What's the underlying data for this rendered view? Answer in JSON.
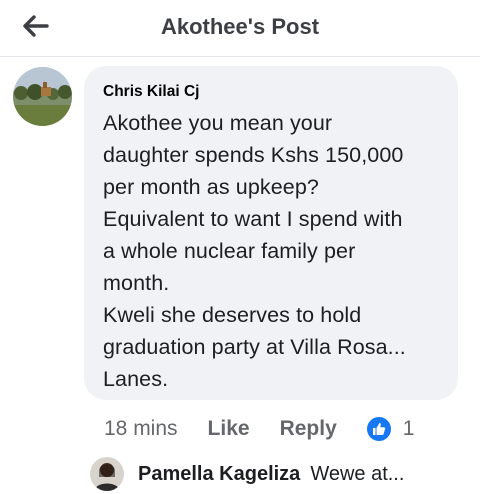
{
  "header": {
    "title": "Akothee's Post",
    "back_icon": "arrow-left-icon"
  },
  "comment": {
    "author": "Chris Kilai Cj",
    "text": "Akothee you mean your\ndaughter spends Kshs 150,000\nper month as upkeep?\nEquivalent to want I spend with\na whole nuclear family per\nmonth.\nKweli she deserves to hold\ngraduation party at Villa Rosa...\nLanes.",
    "time": "18 mins",
    "like_label": "Like",
    "reply_label": "Reply",
    "reaction_icon": "thumbs-up-icon",
    "reaction_count": "1"
  },
  "reply_preview": {
    "author": "Pamella Kageliza",
    "snippet": "Wewe at..."
  },
  "colors": {
    "accent": "#1877f2",
    "bubble": "#f0f2f5",
    "muted": "#65676b"
  }
}
